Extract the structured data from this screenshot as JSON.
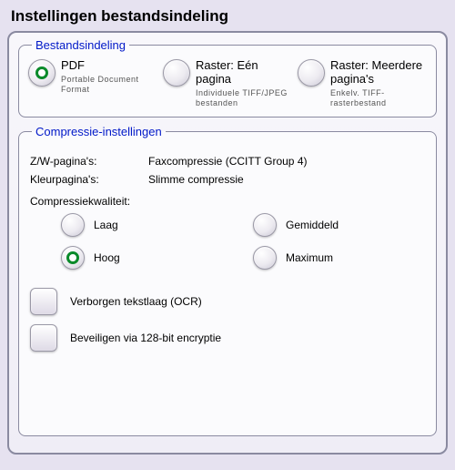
{
  "title": "Instellingen bestandsindeling",
  "format": {
    "legend": "Bestandsindeling",
    "options": [
      {
        "title": "PDF",
        "desc": "Portable Document Format",
        "checked": true
      },
      {
        "title": "Raster: Eén pagina",
        "desc": "Individuele TIFF/JPEG bestanden",
        "checked": false
      },
      {
        "title": "Raster: Meerdere pagina's",
        "desc": "Enkelv. TIFF-rasterbestand",
        "checked": false
      }
    ]
  },
  "compression": {
    "legend": "Compressie-instellingen",
    "bw_label": "Z/W-pagina's:",
    "bw_value": "Faxcompressie (CCITT Group 4)",
    "color_label": "Kleurpagina's:",
    "color_value": "Slimme compressie",
    "quality_label": "Compressiekwaliteit:",
    "quality_options": [
      {
        "label": "Laag",
        "checked": false
      },
      {
        "label": "Gemiddeld",
        "checked": false
      },
      {
        "label": "Hoog",
        "checked": true
      },
      {
        "label": "Maximum",
        "checked": false
      }
    ],
    "ocr_label": "Verborgen tekstlaag (OCR)",
    "ocr_checked": false,
    "encrypt_label": "Beveiligen via 128-bit encryptie",
    "encrypt_checked": false
  }
}
